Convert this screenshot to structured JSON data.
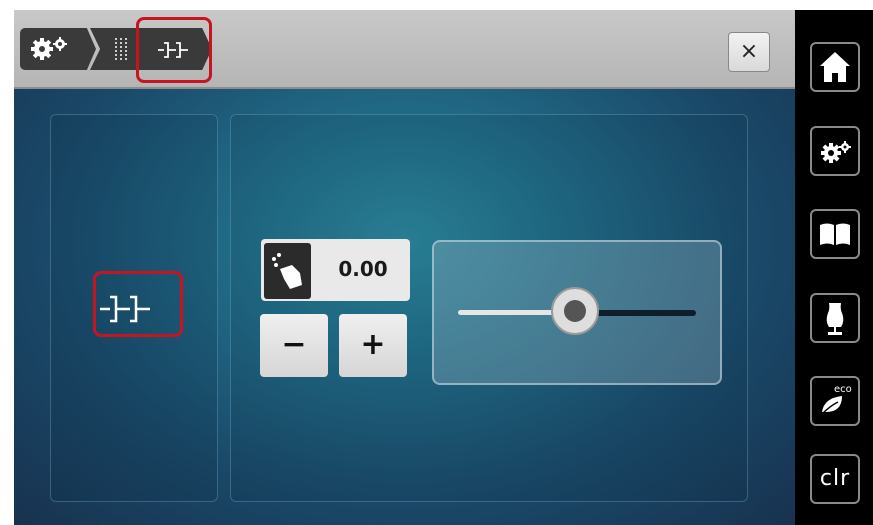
{
  "header": {
    "breadcrumbs": [
      {
        "icon": "settings-gears-icon"
      },
      {
        "icon": "stitch-icon"
      },
      {
        "icon": "thread-tension-icon"
      }
    ],
    "close_label": "×"
  },
  "stitch_icon": "thread-tension-icon",
  "value_control": {
    "icon": "hand-touch-icon",
    "value": "0.00",
    "minus_label": "−",
    "plus_label": "+"
  },
  "slider": {
    "level": 0.5
  },
  "sidebar": {
    "items": [
      {
        "icon": "home-icon"
      },
      {
        "icon": "settings-gears-icon"
      },
      {
        "icon": "book-icon"
      },
      {
        "icon": "dress-form-icon"
      },
      {
        "icon": "eco-leaf-icon",
        "label": "eco"
      },
      {
        "icon": "clr-button",
        "label": "clr"
      }
    ]
  },
  "colors": {
    "highlight": "#c8141e",
    "screen_bg": "#216c88",
    "sidebar_bg": "#000000"
  }
}
